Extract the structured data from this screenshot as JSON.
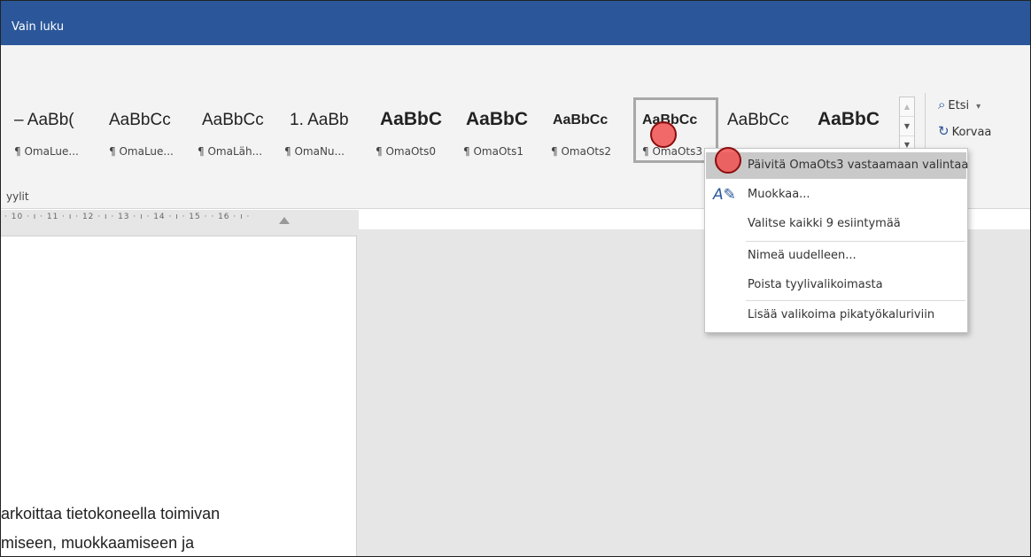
{
  "window": {
    "title": "Vain luku",
    "title_bar_color": "#2b579a"
  },
  "styles_gallery": {
    "group_label": "yylit",
    "items": [
      {
        "sample": "– AaBb(",
        "name": "¶ OmaLue...",
        "bold": false
      },
      {
        "sample": "AaBbCc",
        "name": "¶ OmaLue...",
        "bold": false
      },
      {
        "sample": "AaBbCc",
        "name": "¶ OmaLäh...",
        "bold": false
      },
      {
        "sample": "1. AaBb",
        "name": "¶ OmaNu...",
        "bold": false
      },
      {
        "sample": "AaBbC",
        "name": "¶ OmaOts0",
        "bold": true
      },
      {
        "sample": "AaBbC",
        "name": "¶ OmaOts1",
        "bold": true
      },
      {
        "sample": "AaBbCc",
        "name": "¶ OmaOts2",
        "bold": true
      },
      {
        "sample": "AaBbCc",
        "name": "¶ OmaOts3",
        "bold": true,
        "selected": true
      },
      {
        "sample": "AaBbCc",
        "name": "",
        "bold": false
      },
      {
        "sample": "AaBbC",
        "name": "",
        "bold": true
      }
    ]
  },
  "editing_group": {
    "find_label": "Etsi",
    "find_icon": "search-icon",
    "replace_label": "Korvaa",
    "replace_icon": "replace-icon"
  },
  "ruler": {
    "ticks": "· 10 · ı · 11 · ı · 12 · ı · 13 · ı · 14 · ı · 15 ·   · 16 · ı ·"
  },
  "document": {
    "lines": [
      "arkoittaa tietokoneella toimivan",
      "miseen,   muokkaamiseen   ja"
    ]
  },
  "context_menu": {
    "items": [
      {
        "label": "Päivitä OmaOts3 vastaamaan valintaa",
        "highlighted": true
      },
      {
        "label": "Muokkaa...",
        "icon": "edit-style-icon"
      },
      {
        "label": "Valitse kaikki 9 esiintymää"
      },
      {
        "label": "Nimeä uudelleen..."
      },
      {
        "label": "Poista tyylivalikoimasta"
      },
      {
        "label": "Lisää valikoima pikatyökaluriviin"
      }
    ]
  },
  "colors": {
    "highlight": "#c9c9c9",
    "accent": "#2b579a",
    "click_marker": "#f05050"
  }
}
